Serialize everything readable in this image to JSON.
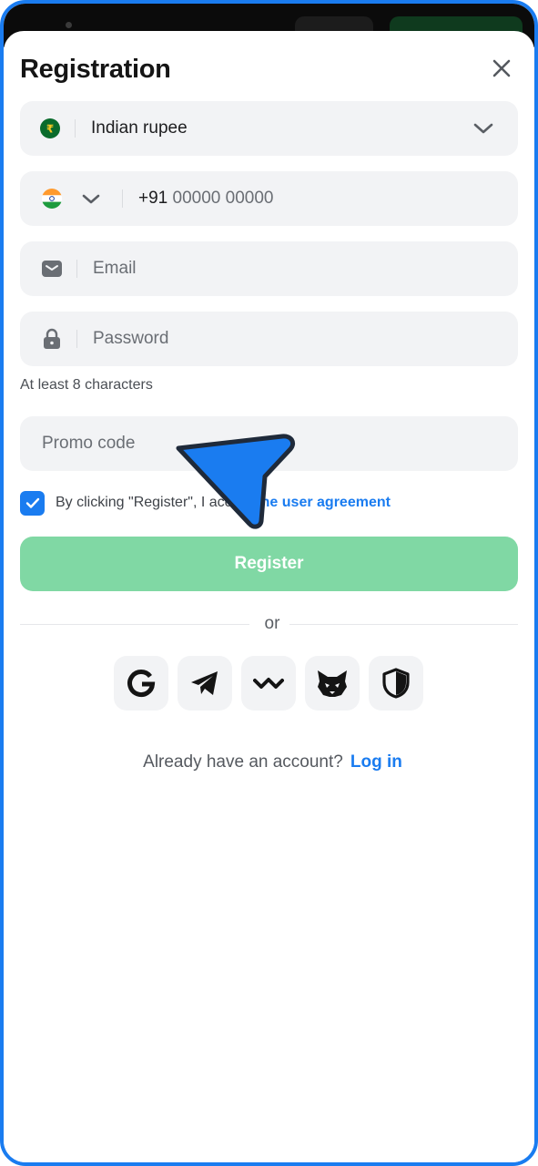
{
  "header": {
    "title": "Registration",
    "close_icon": "close-icon"
  },
  "currency": {
    "value": "Indian rupee",
    "icon": "rupee-coin-icon",
    "dropdown_icon": "chevron-down-icon"
  },
  "phone": {
    "prefix": "+91",
    "placeholder": "00000 00000",
    "flag_icon": "india-flag-icon",
    "dropdown_icon": "chevron-down-icon"
  },
  "email": {
    "placeholder": "Email",
    "icon": "envelope-icon"
  },
  "password": {
    "placeholder": "Password",
    "icon": "lock-icon",
    "hint": "At least 8 characters"
  },
  "promo": {
    "placeholder": "Promo code"
  },
  "agreement": {
    "checked": true,
    "text_before": "By clicking \"Register\", I accept ",
    "link_text": "the user agreement"
  },
  "register_button": {
    "label": "Register"
  },
  "divider": {
    "label": "or"
  },
  "social_logins": [
    {
      "icon": "google-icon"
    },
    {
      "icon": "telegram-icon"
    },
    {
      "icon": "walletconnect-icon"
    },
    {
      "icon": "metamask-fox-icon"
    },
    {
      "icon": "shield-icon"
    }
  ],
  "login_prompt": {
    "text": "Already have an account?",
    "link": "Log in"
  },
  "colors": {
    "accent": "#1a7cf0",
    "register_button": "#80d8a4",
    "field_background": "#f2f3f5"
  }
}
